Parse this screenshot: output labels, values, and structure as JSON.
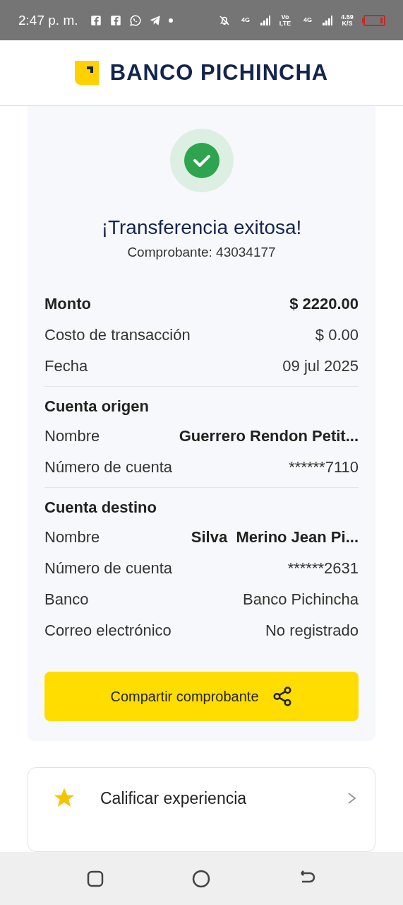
{
  "status_bar": {
    "time": "2:47 p. m.",
    "indicators": [
      "4G",
      "Vo LTE",
      "4G",
      "4.59 K/S"
    ]
  },
  "header": {
    "brand": "BANCO PICHINCHA"
  },
  "receipt": {
    "title": "¡Transferencia exitosa!",
    "subtitle": "Comprobante: 43034177",
    "sections": [
      {
        "rows": [
          {
            "kind": "total",
            "label": "Monto",
            "value": "$ 2220.00"
          },
          {
            "kind": "plain",
            "label": "Costo de transacción",
            "value": "$ 0.00"
          },
          {
            "kind": "plain",
            "label": "Fecha",
            "value": "09 jul 2025"
          }
        ]
      },
      {
        "title": "Cuenta origen",
        "rows": [
          {
            "kind": "name",
            "label": "Nombre",
            "value": "Guerrero Rendon Petit..."
          },
          {
            "kind": "plain",
            "label": "Número de cuenta",
            "value": "******7110"
          }
        ]
      },
      {
        "title": "Cuenta destino",
        "rows": [
          {
            "kind": "name",
            "label": "Nombre",
            "value": "Silva  Merino Jean Pi..."
          },
          {
            "kind": "plain",
            "label": "Número de cuenta",
            "value": "******2631"
          },
          {
            "kind": "plain",
            "label": "Banco",
            "value": "Banco Pichincha"
          },
          {
            "kind": "plain",
            "label": "Correo electrónico",
            "value": "No registrado"
          }
        ]
      }
    ],
    "share_button": "Compartir comprobante"
  },
  "rating": {
    "label": "Calificar experiencia"
  }
}
